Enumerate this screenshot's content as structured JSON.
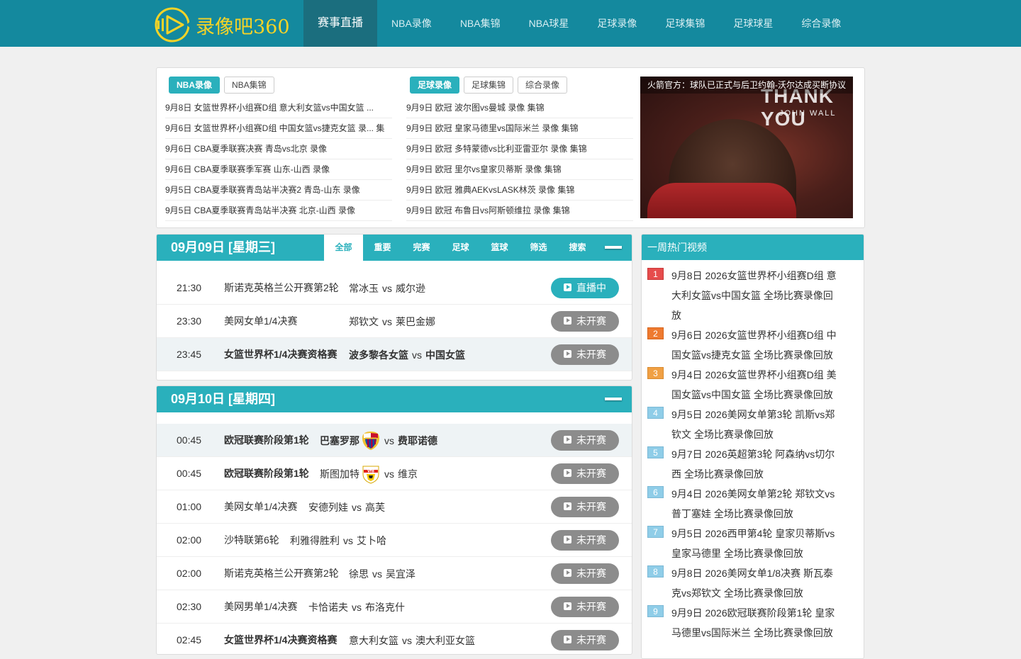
{
  "logo": {
    "text": "录像吧360"
  },
  "nav": [
    {
      "label": "赛事直播",
      "active": true
    },
    {
      "label": "NBA录像"
    },
    {
      "label": "NBA集锦"
    },
    {
      "label": "NBA球星"
    },
    {
      "label": "足球录像"
    },
    {
      "label": "足球集锦"
    },
    {
      "label": "足球球星"
    },
    {
      "label": "综合录像"
    }
  ],
  "feature": {
    "col1": {
      "tabs": [
        "NBA录像",
        "NBA集锦"
      ],
      "items": [
        "9月8日 女篮世界杯小组赛D组 意大利女篮vs中国女篮 ...",
        "9月6日 女篮世界杯小组赛D组 中国女篮vs捷克女篮 录... 集",
        "9月6日 CBA夏季联赛决赛 青岛vs北京 录像",
        "9月6日 CBA夏季联赛季军赛 山东-山西 录像",
        "9月5日 CBA夏季联赛青岛站半决赛2 青岛-山东 录像",
        "9月5日 CBA夏季联赛青岛站半决赛 北京-山西 录像"
      ]
    },
    "col2": {
      "tabs": [
        "足球录像",
        "足球集锦",
        "综合录像"
      ],
      "items": [
        "9月9日 欧冠 波尔图vs曼城 录像 集锦",
        "9月9日 欧冠 皇家马德里vs国际米兰 录像 集锦",
        "9月9日 欧冠 多特蒙德vs比利亚雷亚尔 录像 集锦",
        "9月9日 欧冠 里尔vs皇家贝蒂斯 录像 集锦",
        "9月9日 欧冠 雅典AEKvsLASK林茨 录像 集锦",
        "9月9日 欧冠 布鲁日vs阿斯顿维拉 录像 集锦"
      ]
    },
    "image": {
      "caption": "火箭官方：球队已正式与后卫约翰-沃尔达成买断协议",
      "overlay_big": "THANK YOU",
      "overlay_small": "JOHN WALL"
    }
  },
  "day1": {
    "title": "09月09日 [星期三]",
    "tabs": [
      "全部",
      "重要",
      "完赛",
      "足球",
      "篮球",
      "筛选",
      "搜索"
    ],
    "matches": [
      {
        "time": "21:30",
        "league": "斯诺克英格兰公开赛第2轮",
        "home": "常冰玉",
        "away": "威尔逊",
        "status": "直播中",
        "live": true
      },
      {
        "time": "23:30",
        "league": "美网女单1/4决赛",
        "home": "郑钦文",
        "away": "莱巴金娜",
        "status": "未开赛"
      },
      {
        "time": "23:45",
        "league": "女篮世界杯1/4决赛资格赛",
        "home": "波多黎各女篮",
        "away": "中国女篮",
        "status": "未开赛",
        "bold": true,
        "hl": true
      }
    ]
  },
  "day2": {
    "title": "09月10日 [星期四]",
    "matches": [
      {
        "time": "00:45",
        "league": "欧冠联赛阶段第1轮",
        "home": "巴塞罗那",
        "away": "费耶诺德",
        "status": "未开赛",
        "bold": true,
        "hl": true,
        "crest": "barcelona-crest-icon"
      },
      {
        "time": "00:45",
        "league": "欧冠联赛阶段第1轮",
        "home": "斯图加特",
        "away": "维京",
        "status": "未开赛",
        "leagueBold": true,
        "crest": "stuttgart-crest-icon"
      },
      {
        "time": "01:00",
        "league": "美网女单1/4决赛",
        "home": "安德列娃",
        "away": "高芙",
        "status": "未开赛"
      },
      {
        "time": "02:00",
        "league": "沙特联第6轮",
        "home": "利雅得胜利",
        "away": "艾卜哈",
        "status": "未开赛"
      },
      {
        "time": "02:00",
        "league": "斯诺克英格兰公开赛第2轮",
        "home": "徐思",
        "away": "吴宜泽",
        "status": "未开赛"
      },
      {
        "time": "02:30",
        "league": "美网男单1/4决赛",
        "home": "卡恰诺夫",
        "away": "布洛克什",
        "status": "未开赛"
      },
      {
        "time": "02:45",
        "league": "女篮世界杯1/4决赛资格赛",
        "home": "意大利女篮",
        "away": "澳大利亚女篮",
        "status": "未开赛",
        "bold": true
      }
    ]
  },
  "hot": {
    "title": "一周热门视频",
    "items": [
      "9月8日 2026女篮世界杯小组赛D组 意大利女篮vs中国女篮 全场比赛录像回放",
      "9月6日 2026女篮世界杯小组赛D组 中国女篮vs捷克女篮 全场比赛录像回放",
      "9月4日 2026女篮世界杯小组赛D组 美国女篮vs中国女篮 全场比赛录像回放",
      "9月5日 2026美网女单第3轮 凯斯vs郑钦文 全场比赛录像回放",
      "9月7日 2026英超第3轮 阿森纳vs切尔西 全场比赛录像回放",
      "9月4日 2026美网女单第2轮 郑钦文vs普丁塞娃 全场比赛录像回放",
      "9月5日 2026西甲第4轮 皇家贝蒂斯vs皇家马德里 全场比赛录像回放",
      "9月8日 2026美网女单1/8决赛 斯瓦泰克vs郑钦文 全场比赛录像回放",
      "9月9日 2026欧冠联赛阶段第1轮 皇家马德里vs国际米兰 全场比赛录像回放"
    ]
  },
  "colors": {
    "teal": "#2ab0bc",
    "nav_bg": "#14899e",
    "nav_active": "#1b6e7e",
    "logo_yellow": "#f5d327",
    "status_grey": "#8c8c8c"
  }
}
